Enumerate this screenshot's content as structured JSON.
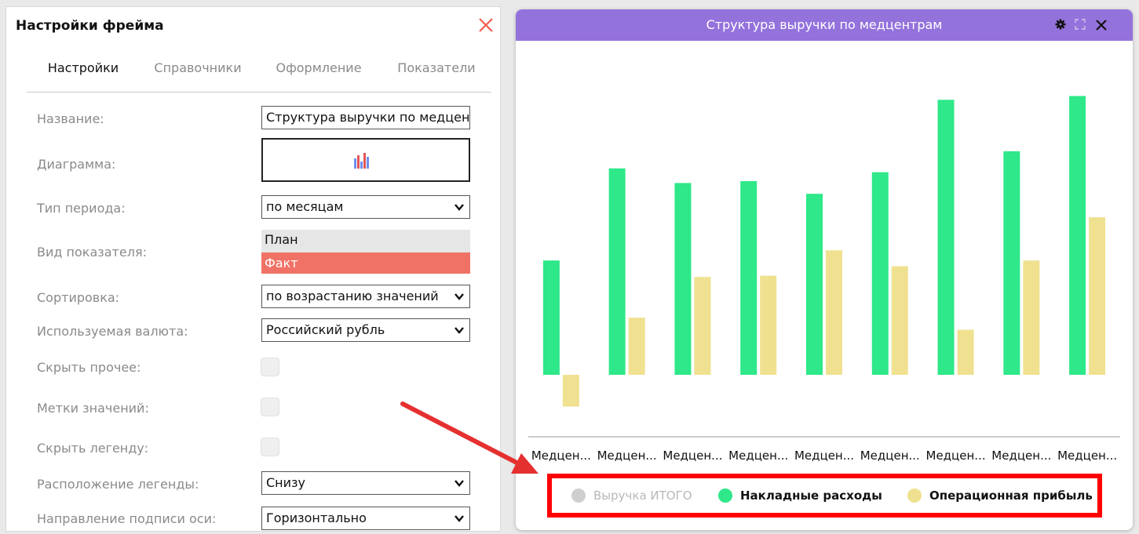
{
  "settings_panel": {
    "title": "Настройки фрейма",
    "tabs": [
      "Настройки",
      "Справочники",
      "Оформление",
      "Показатели"
    ],
    "fields": {
      "name_label": "Название:",
      "name_value": "Структура выручки по медцентрам",
      "diagram_label": "Диаграмма:",
      "period_label": "Тип периода:",
      "period_value": "по месяцам",
      "indicator_label": "Вид показателя:",
      "indicator_options": [
        "План",
        "Факт"
      ],
      "indicator_selected": "Факт",
      "sort_label": "Сортировка:",
      "sort_value": "по возрастанию значений",
      "currency_label": "Используемая валюта:",
      "currency_value": "Российский рубль",
      "hide_other_label": "Скрыть прочее:",
      "value_labels_label": "Метки значений:",
      "hide_legend_label": "Скрыть легенду:",
      "legend_pos_label": "Расположение легенды:",
      "legend_pos_value": "Снизу",
      "axis_dir_label": "Направление подписи оси:",
      "axis_dir_value": "Горизонтально"
    },
    "checkboxes": {
      "hide_other": false,
      "value_labels": false,
      "hide_legend": false
    }
  },
  "chart_panel": {
    "title": "Структура выручки по медцентрам",
    "header_color": "#9472dc",
    "icons": [
      "gear-icon",
      "expand-icon",
      "close-icon"
    ]
  },
  "chart_data": {
    "type": "bar",
    "title": "Структура выручки по медцентрам",
    "categories": [
      "Медцен...",
      "Медцен...",
      "Медцен...",
      "Медцен...",
      "Медцен...",
      "Медцен...",
      "Медцен...",
      "Медцен...",
      "Медцен..."
    ],
    "series": [
      {
        "name": "Выручка ИТОГО",
        "color": "#c8c8c8",
        "hidden": true,
        "values": []
      },
      {
        "name": "Накладные расходы",
        "color": "#2ee889",
        "values": [
          18.0,
          32.5,
          30.2,
          30.5,
          28.5,
          31.9,
          43.3,
          35.2,
          43.9
        ]
      },
      {
        "name": "Операционная прибыль",
        "color": "#efe190",
        "values": [
          -5.0,
          9.0,
          15.4,
          15.6,
          19.6,
          17.1,
          7.1,
          18.0,
          24.8
        ]
      }
    ],
    "ylim": [
      -8,
      48
    ],
    "grid": false,
    "legend_position": "bottom"
  },
  "colors": {
    "accent_red": "#ff0000",
    "selected_item": "#f07266",
    "close_icon": "#f15b4f"
  }
}
